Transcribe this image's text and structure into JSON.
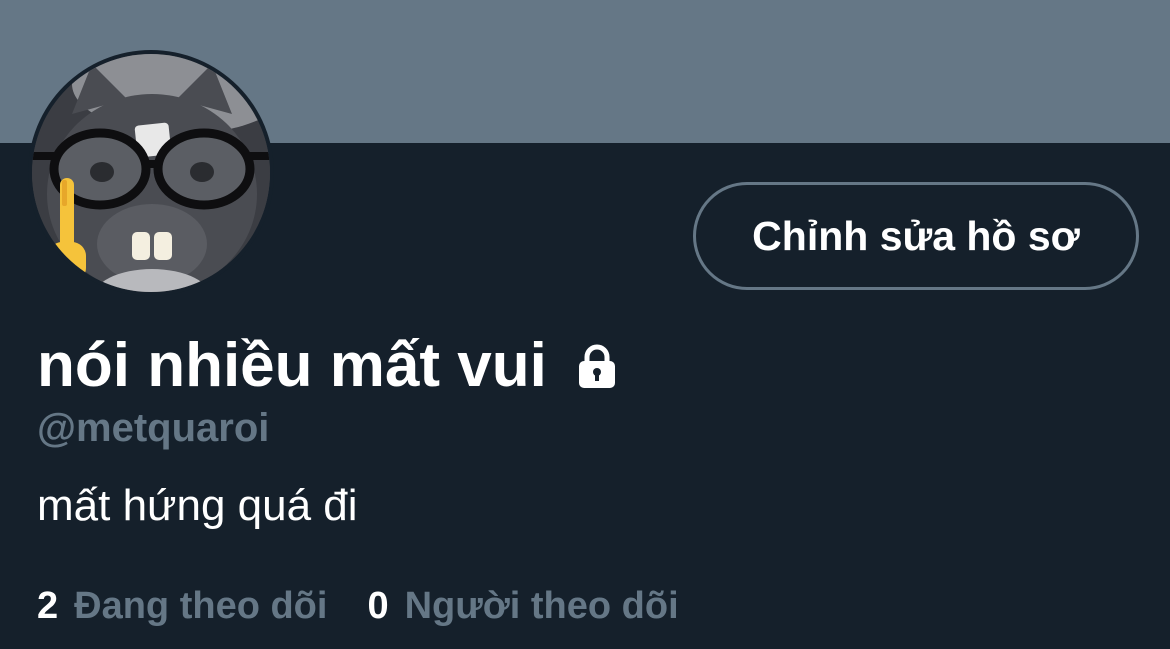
{
  "profile": {
    "display_name": "nói nhiều mất vui",
    "handle": "@metquaroi",
    "bio": "mất hứng quá đi",
    "protected_icon": "lock-icon",
    "avatar_icon": "avatar-photo"
  },
  "actions": {
    "edit_profile_label": "Chỉnh sửa hồ sơ"
  },
  "stats": {
    "following_count": "2",
    "following_label": "Đang theo dõi",
    "followers_count": "0",
    "followers_label": "Người theo dõi"
  },
  "colors": {
    "background": "#15202b",
    "banner": "#657786",
    "secondary_text": "#657786",
    "primary_text": "#ffffff"
  }
}
